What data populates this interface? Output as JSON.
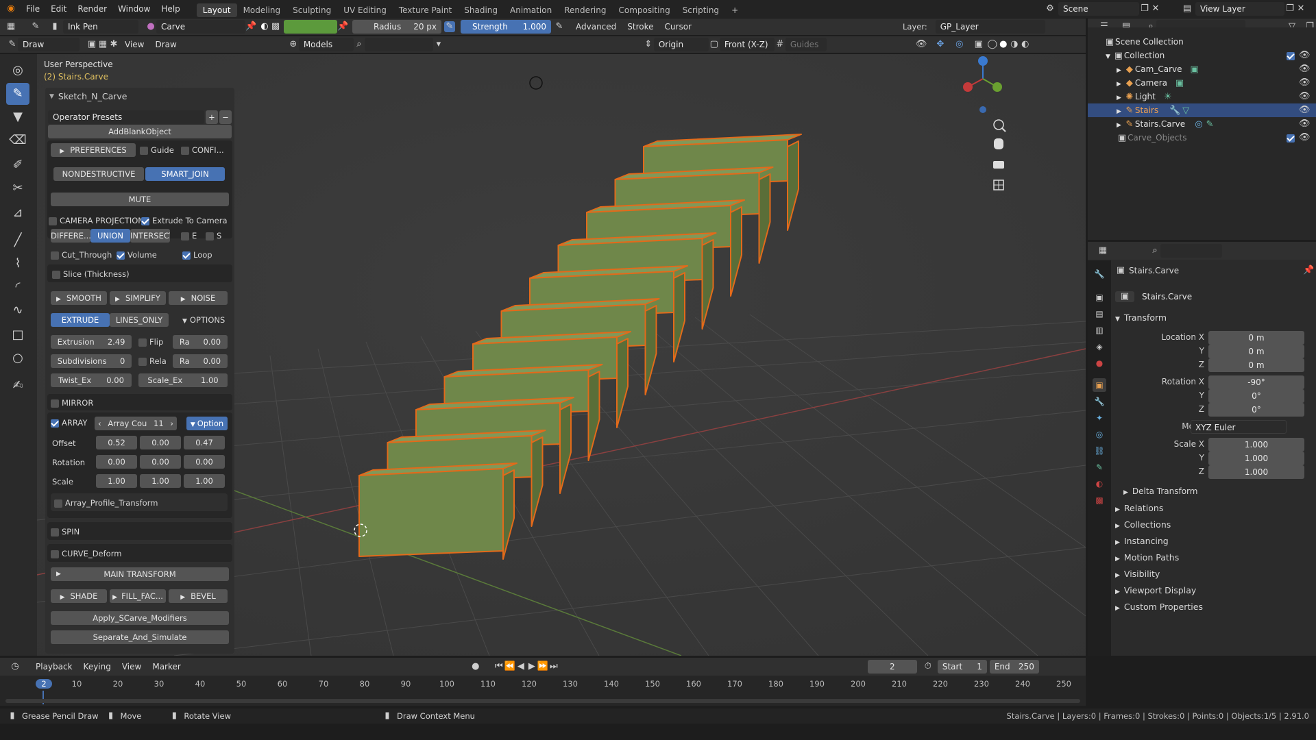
{
  "topbar": {
    "menus": [
      "File",
      "Edit",
      "Render",
      "Window",
      "Help"
    ],
    "workspaces": [
      "Layout",
      "Modeling",
      "Sculpting",
      "UV Editing",
      "Texture Paint",
      "Shading",
      "Animation",
      "Rendering",
      "Compositing",
      "Scripting"
    ],
    "active_workspace": "Layout",
    "add_tab": "+",
    "scene": "Scene",
    "view_layer": "View Layer"
  },
  "tool_header": {
    "brush": "Ink Pen",
    "material": "Carve",
    "radius_label": "Radius",
    "radius_value": "20 px",
    "strength_label": "Strength",
    "strength_value": "1.000",
    "advanced": "Advanced",
    "stroke": "Stroke",
    "cursor": "Cursor",
    "layer_label": "Layer:",
    "layer_value": "GP_Layer",
    "color": "#5c9a3c"
  },
  "viewport_header": {
    "mode": "Draw",
    "view": "View",
    "draw": "Draw",
    "models": "Models",
    "origin": "Origin",
    "plane": "Front (X-Z)",
    "guides": "Guides"
  },
  "viewport": {
    "perspective": "User Perspective",
    "object": "(2) Stairs.Carve"
  },
  "npanel": {
    "title": "Sketch_N_Carve",
    "presets": "Operator Presets",
    "add_blank": "AddBlankObject",
    "preferences": "PREFERENCES",
    "guide": "Guide",
    "config": "CONFI...",
    "nondestructive": "NONDESTRUCTIVE",
    "smart_join": "SMART_JOIN",
    "mute": "MUTE",
    "camera_projection": "CAMERA PROJECTION",
    "extrude_to_camera": "Extrude To Camera",
    "difference": "DIFFERE...",
    "union": "UNION",
    "intersect": "INTERSECT",
    "e": "E",
    "s": "S",
    "cut_through": "Cut_Through",
    "volume": "Volume",
    "loop": "Loop",
    "slice": "Slice (Thickness)",
    "smooth": "SMOOTH",
    "simplify": "SIMPLIFY",
    "noise": "NOISE",
    "extrude": "EXTRUDE",
    "lines_only": "LINES_ONLY",
    "options": "OPTIONS",
    "extrusion_label": "Extrusion",
    "extrusion_value": "2.49",
    "flip": "Flip",
    "ra1_label": "Ra",
    "ra1_value": "0.00",
    "subdivisions_label": "Subdivisions",
    "subdivisions_value": "0",
    "rela": "Rela",
    "ra2_label": "Ra",
    "ra2_value": "0.00",
    "twist_label": "Twist_Ex",
    "twist_value": "0.00",
    "scale_ex_label": "Scale_Ex",
    "scale_ex_value": "1.00",
    "mirror": "MIRROR",
    "array": "ARRAY",
    "array_count_label": "Array Cou",
    "array_count_value": "11",
    "option": "Option",
    "offset_label": "Offset",
    "offset": [
      "0.52",
      "0.00",
      "0.47"
    ],
    "rotation_label": "Rotation",
    "rotation": [
      "0.00",
      "0.00",
      "0.00"
    ],
    "scale_label": "Scale",
    "scale": [
      "1.00",
      "1.00",
      "1.00"
    ],
    "array_profile": "Array_Profile_Transform",
    "spin": "SPIN",
    "curve_deform": "CURVE_Deform",
    "main_transform": "MAIN TRANSFORM",
    "shade": "SHADE",
    "fill_fac": "FILL_FAC...",
    "bevel": "BEVEL",
    "apply": "Apply_SCarve_Modifiers",
    "separate": "Separate_And_Simulate"
  },
  "outliner": {
    "scene_collection": "Scene Collection",
    "collection": "Collection",
    "items": [
      "Cam_Carve",
      "Camera",
      "Light",
      "Stairs",
      "Stairs.Carve"
    ],
    "carve_objects": "Carve_Objects"
  },
  "properties": {
    "object_name": "Stairs.Carve",
    "data_name": "Stairs.Carve",
    "transform": "Transform",
    "location_label": "Location X",
    "location": [
      "0 m",
      "0 m",
      "0 m"
    ],
    "rotation_label": "Rotation X",
    "rotation": [
      "-90°",
      "0°",
      "0°"
    ],
    "mode_label": "Mode",
    "mode": "XYZ Euler",
    "scale_label": "Scale X",
    "scale": [
      "1.000",
      "1.000",
      "1.000"
    ],
    "y": "Y",
    "z": "Z",
    "delta": "Delta Transform",
    "panels": [
      "Relations",
      "Collections",
      "Instancing",
      "Motion Paths",
      "Visibility",
      "Viewport Display",
      "Custom Properties"
    ]
  },
  "timeline": {
    "playback": "Playback",
    "keying": "Keying",
    "view": "View",
    "marker": "Marker",
    "current_frame": "2",
    "start_label": "Start",
    "start": "1",
    "end_label": "End",
    "end": "250",
    "ticks": [
      "2",
      "10",
      "20",
      "30",
      "40",
      "50",
      "60",
      "70",
      "80",
      "90",
      "100",
      "110",
      "120",
      "130",
      "140",
      "150",
      "160",
      "170",
      "180",
      "190",
      "200",
      "210",
      "220",
      "230",
      "240",
      "250"
    ]
  },
  "statusbar": {
    "hint1": "Grease Pencil Draw",
    "hint2": "Move",
    "hint3": "Rotate View",
    "hint4": "Draw Context Menu",
    "stats": "Stairs.Carve | Layers:0 | Frames:0 | Strokes:0 | Points:0 | Objects:1/5 | 2.91.0"
  }
}
